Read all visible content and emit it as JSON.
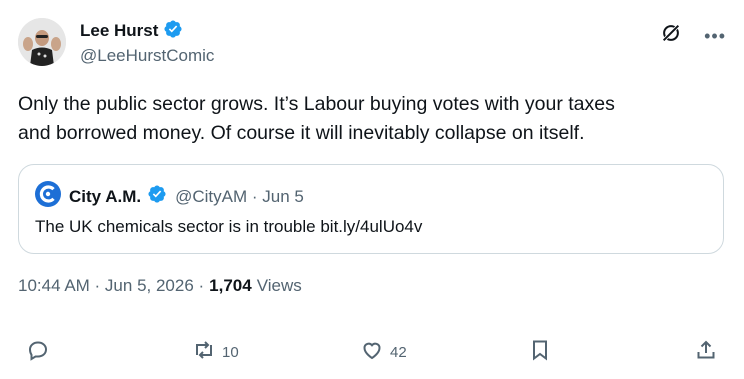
{
  "author": {
    "display_name": "Lee Hurst",
    "handle": "@LeeHurstComic"
  },
  "icons": {
    "verified": "verified-badge-icon",
    "grok": "grok-icon",
    "more": "more-icon",
    "reply": "reply-icon",
    "retweet": "retweet-icon",
    "like": "heart-icon",
    "bookmark": "bookmark-icon",
    "share": "share-icon"
  },
  "tweet": {
    "text": "Only the public sector grows. It’s Labour buying votes with your taxes\nand borrowed money. Of course it will inevitably collapse on itself."
  },
  "quote": {
    "display_name": "City A.M.",
    "meta": "@CityAM · Jun 5",
    "text": "The UK chemicals sector is in trouble bit.ly/4ulUo4v"
  },
  "meta": {
    "timestamp": "10:44 AM · Jun 5, 2026 ·",
    "views_count": "1,704",
    "views_label": "Views"
  },
  "actions": {
    "retweets": "10",
    "likes": "42"
  },
  "colors": {
    "verified": "#1d9bf0",
    "text": "#0f1419",
    "secondary": "#536471",
    "border": "#cfd9de"
  }
}
